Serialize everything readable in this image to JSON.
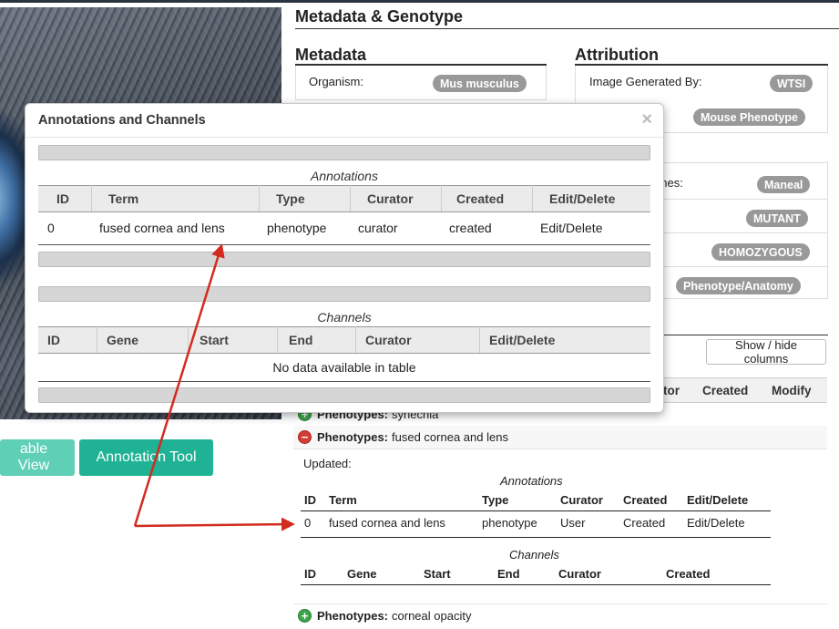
{
  "right_panel": {
    "title": "Metadata & Genotype",
    "metadata": {
      "title": "Metadata",
      "organism_label": "Organism:",
      "organism_value": "Mus musculus"
    },
    "attribution": {
      "title": "Attribution",
      "generated_by_label": "Image Generated By:",
      "generated_by_value": "WTSI",
      "project_value": "Mouse Phenotype"
    },
    "genotype": {
      "genes_label_fragment": "enes:",
      "gene_value": "Maneal",
      "type_value": "MUTANT",
      "zygosity_value": "HOMOZYGOUS",
      "annotation_value": "Phenotype/Anatomy"
    },
    "show_hide_label": "Show / hide columns",
    "bg_headers": [
      "tor",
      "Created",
      "Modify"
    ],
    "phenotype_label": "Phenotypes:",
    "phenotypes": [
      "synechia",
      "fused cornea and lens",
      "corneal opacity"
    ],
    "updated_label": "Updated:",
    "annotations_caption": "Annotations",
    "annotations_headers": [
      "ID",
      "Term",
      "Type",
      "Curator",
      "Created",
      "Edit/Delete"
    ],
    "annotations_row": [
      "0",
      "fused cornea and lens",
      "phenotype",
      "User",
      "Created",
      "Edit/Delete"
    ],
    "channels_caption": "Channels",
    "channels_headers": [
      "ID",
      "Gene",
      "Start",
      "End",
      "Curator",
      "Created"
    ]
  },
  "buttons": {
    "table_view": "able View",
    "annotation_tool": "Annotation Tool"
  },
  "modal": {
    "title": "Annotations and Channels",
    "close": "×",
    "annotations_caption": "Annotations",
    "annotations_headers": [
      "ID",
      "Term",
      "Type",
      "Curator",
      "Created",
      "Edit/Delete"
    ],
    "annotations_row": [
      "0",
      "fused cornea and lens",
      "phenotype",
      "curator",
      "created",
      "Edit/Delete"
    ],
    "channels_caption": "Channels",
    "channels_headers": [
      "ID",
      "Gene",
      "Start",
      "End",
      "Curator",
      "Edit/Delete"
    ],
    "channels_empty": "No data available in table"
  },
  "colors": {
    "accent_teal": "#1fb295",
    "accent_teal_light": "#5fcfb6",
    "badge_gray": "#999999",
    "arrow_red": "#d32b1f",
    "plus_green": "#3ca54a",
    "minus_red": "#d23b36"
  }
}
